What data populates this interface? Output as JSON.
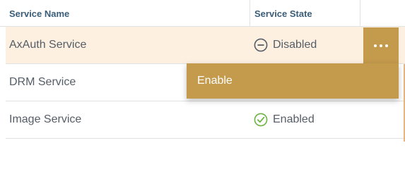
{
  "table": {
    "headers": {
      "service_name": "Service Name",
      "service_state": "Service State"
    },
    "rows": [
      {
        "name": "AxAuth Service",
        "state": "Disabled",
        "state_icon": "minus-circle-icon",
        "highlighted": true
      },
      {
        "name": "DRM Service",
        "state": "",
        "state_icon": ""
      },
      {
        "name": "Image Service",
        "state": "Enabled",
        "state_icon": "check-circle-icon"
      }
    ]
  },
  "action_menu": {
    "trigger_icon": "more-horizontal-icon",
    "items": [
      {
        "label": "Enable"
      }
    ]
  },
  "colors": {
    "accent": "#c49a4d",
    "row_highlight": "#fdf0e1",
    "header_text": "#3b5d78",
    "body_text": "#555d66",
    "enabled_green": "#6cb33f",
    "disabled_gray": "#555d66"
  }
}
